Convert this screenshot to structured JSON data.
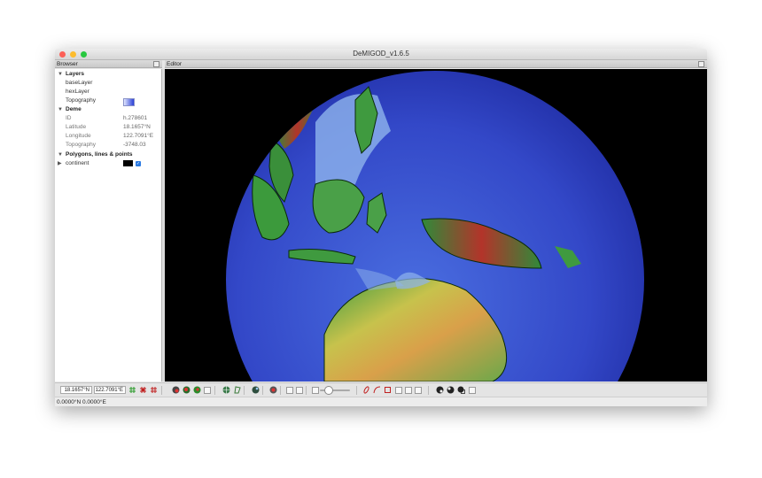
{
  "window": {
    "title": "DeMIGOD_v1.6.5"
  },
  "panels": {
    "browser_title": "Browser",
    "editor_title": "Editor"
  },
  "browser": {
    "layers": {
      "label": "Layers",
      "items": [
        "baseLayer",
        "hexLayer",
        "Topography"
      ]
    },
    "deme": {
      "label": "Deme",
      "fields": [
        {
          "name": "ID",
          "value": "h.278601"
        },
        {
          "name": "Latitude",
          "value": "18.1657°N"
        },
        {
          "name": "Longitude",
          "value": "122.7091°E"
        },
        {
          "name": "Topography",
          "value": "-3748.03"
        }
      ]
    },
    "polygons": {
      "label": "Polygons, lines & points",
      "items": [
        "continent"
      ]
    }
  },
  "toolbar": {
    "latitude": "18.1657°N",
    "longitude": "122.7091°E",
    "slider_value": 0.15
  },
  "status": {
    "coords": "0.0000°N 0.0000°E"
  },
  "colors": {
    "ocean_deep": "#2632b8",
    "ocean_mid": "#3d5bd8",
    "shelf": "#8fb4ec",
    "land_low": "#2f8a3a",
    "land_mid": "#c9b84a",
    "land_high": "#b3342a",
    "editor_bg": "#000000"
  }
}
